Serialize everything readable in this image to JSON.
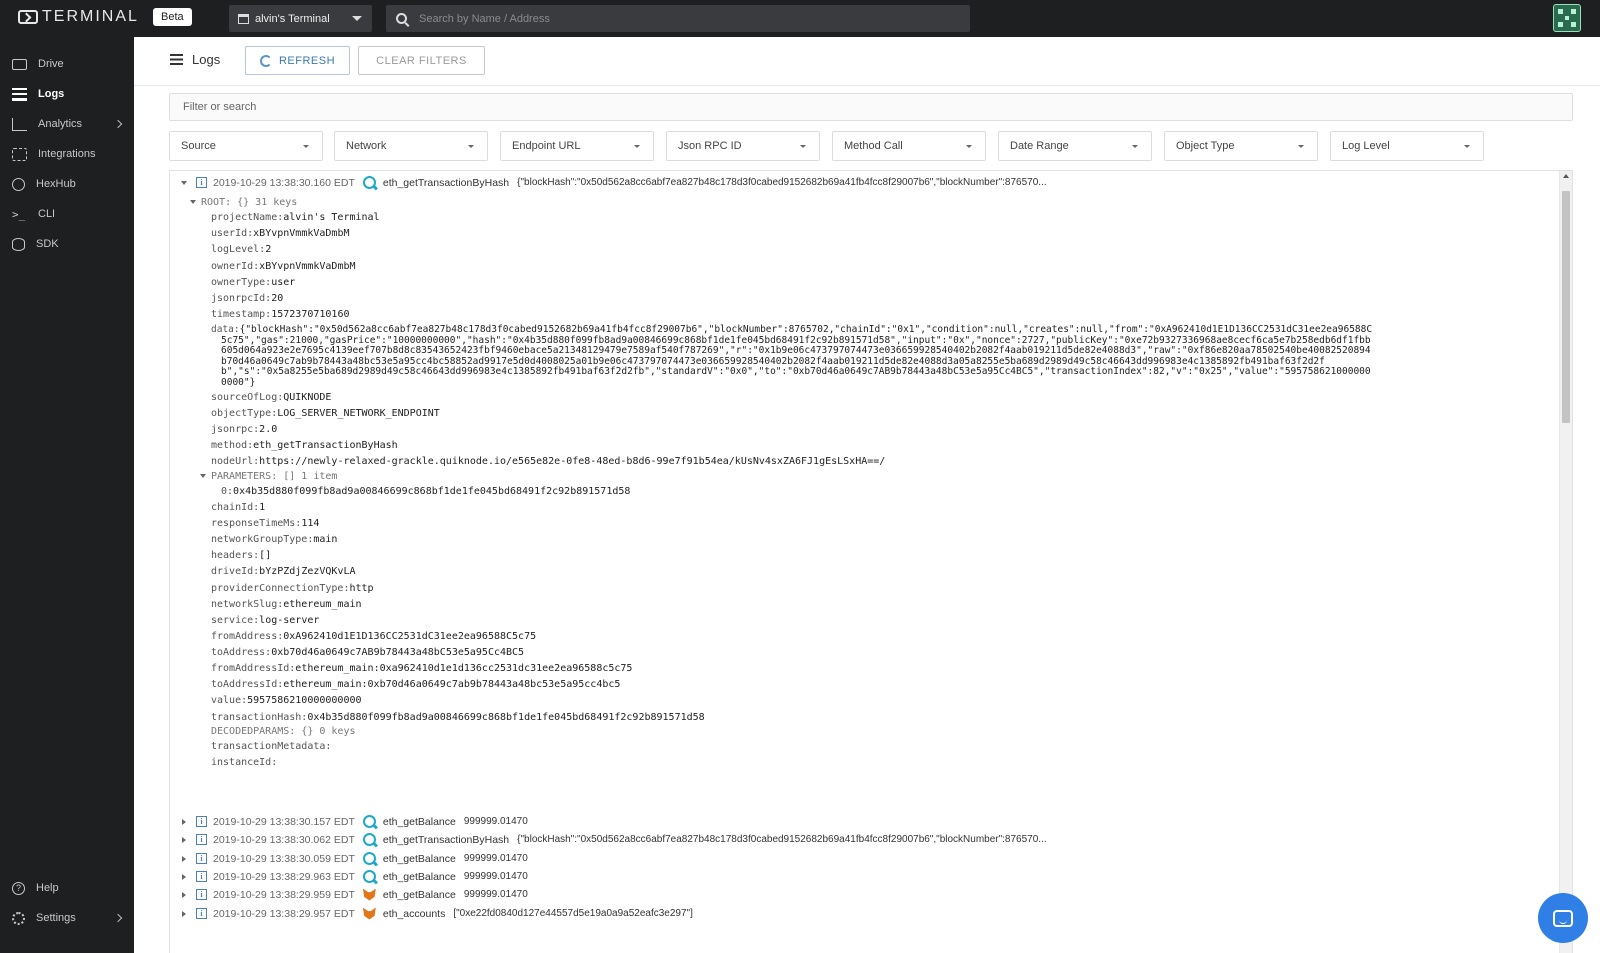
{
  "app": {
    "logo_text": "TERMINAL",
    "beta_label": "Beta",
    "project_name": "alvin's Terminal",
    "search_placeholder": "Search by Name / Address"
  },
  "sidebar": {
    "items": [
      {
        "label": "Drive",
        "icon": "folder-icon"
      },
      {
        "label": "Logs",
        "icon": "list-icon",
        "active": true
      },
      {
        "label": "Analytics",
        "icon": "chart-icon",
        "has_submenu": true
      },
      {
        "label": "Integrations",
        "icon": "plug-icon"
      },
      {
        "label": "HexHub",
        "icon": "globe-icon"
      },
      {
        "label": "CLI",
        "icon": "terminal-prompt-icon"
      },
      {
        "label": "SDK",
        "icon": "database-icon"
      }
    ],
    "bottom": [
      {
        "label": "Help",
        "icon": "help-icon"
      },
      {
        "label": "Settings",
        "icon": "gear-icon",
        "has_submenu": true
      }
    ]
  },
  "toolbar": {
    "title": "Logs",
    "refresh_label": "REFRESH",
    "clear_label": "CLEAR FILTERS",
    "filter_placeholder": "Filter or search"
  },
  "filters": [
    "Source",
    "Network",
    "Endpoint URL",
    "Json RPC ID",
    "Method Call",
    "Date Range",
    "Object Type",
    "Log Level"
  ],
  "expanded_log": {
    "timestamp": "2019-10-29  13:38:30.160  EDT",
    "method": "eth_getTransactionByHash",
    "payload": "{\"blockHash\":\"0x50d562a8cc6abf7ea827b48c178d3f0cabed9152682b69a41fb4fcc8f29007b6\",\"blockNumber\":876570...",
    "root_label": "ROOT:  {}  31 keys",
    "fields_a": [
      {
        "k": "projectName:",
        "v": "alvin's Terminal"
      },
      {
        "k": "userId:",
        "v": "xBYvpnVmmkVaDmbM"
      },
      {
        "k": "logLevel:",
        "v": "2"
      },
      {
        "k": "ownerId:",
        "v": "xBYvpnVmmkVaDmbM"
      },
      {
        "k": "ownerType:",
        "v": "user"
      },
      {
        "k": "jsonrpcId:",
        "v": "20"
      },
      {
        "k": "timestamp:",
        "v": "1572370710160"
      }
    ],
    "data_key": "data:",
    "data_lines": [
      "{\"blockHash\":\"0x50d562a8cc6abf7ea827b48c178d3f0cabed9152682b69a41fb4fcc8f29007b6\",\"blockNumber\":8765702,\"chainId\":\"0x1\",\"condition\":null,\"creates\":null,\"from\":\"0xA962410d1E1D136CC2531dC31ee2ea96588C",
      "5c75\",\"gas\":21000,\"gasPrice\":\"10000000000\",\"hash\":\"0x4b35d880f099fb8ad9a00846699c868bf1de1fe045bd68491f2c92b891571d58\",\"input\":\"0x\",\"nonce\":2727,\"publicKey\":\"0xe72b9327336968ae8cecf6ca5e7b258edb6df1fbb",
      "605d064a923e2e7695c4139eef707b8d8c83543652423fbf9460ebace5a21348129479e7589af540f787269\",\"r\":\"0x1b9e06c473797074473e036659928540402b2082f4aab019211d5de82e4088d3\",\"raw\":\"0xf86e820aa78502540be40082520894",
      "b70d46a0649c7ab9b78443a48bc53e5a95cc4bc58852ad9917e5d0d4008025a01b9e06c473797074473e036659928540402b2082f4aab019211d5de82e4088d3a05a8255e5ba689d2989d49c58c46643dd996983e4c1385892fb491baf63f2d2f",
      "b\",\"s\":\"0x5a8255e5ba689d2989d49c58c46643dd996983e4c1385892fb491baf63f2d2fb\",\"standardV\":\"0x0\",\"to\":\"0xb70d46a0649c7AB9b78443a48bC53e5a95Cc4BC5\",\"transactionIndex\":82,\"v\":\"0x25\",\"value\":\"595758621000000",
      "0000\"}"
    ],
    "fields_b": [
      {
        "k": "sourceOfLog:",
        "v": "QUIKNODE"
      },
      {
        "k": "objectType:",
        "v": "LOG_SERVER_NETWORK_ENDPOINT"
      },
      {
        "k": "jsonrpc:",
        "v": "2.0"
      },
      {
        "k": "method:",
        "v": "eth_getTransactionByHash"
      },
      {
        "k": "nodeUrl:",
        "v": "https://newly-relaxed-grackle.quiknode.io/e565e82e-0fe8-48ed-b8d6-99e7f91b54ea/kUsNv4sxZA6FJ1gEsLSxHA==/"
      }
    ],
    "params_label": "PARAMETERS:  []  1 item",
    "param0_key": "0:",
    "param0_value": "0x4b35d880f099fb8ad9a00846699c868bf1de1fe045bd68491f2c92b891571d58",
    "fields_c": [
      {
        "k": "chainId:",
        "v": "1"
      },
      {
        "k": "responseTimeMs:",
        "v": "114"
      },
      {
        "k": "networkGroupType:",
        "v": "main"
      },
      {
        "k": "headers:",
        "v": "[]"
      },
      {
        "k": "driveId:",
        "v": "bYzPZdjZezVQKvLA"
      },
      {
        "k": "providerConnectionType:",
        "v": "http"
      },
      {
        "k": "networkSlug:",
        "v": "ethereum_main"
      },
      {
        "k": "service:",
        "v": "log-server"
      },
      {
        "k": "fromAddress:",
        "v": "0xA962410d1E1D136CC2531dC31ee2ea96588C5c75"
      },
      {
        "k": "toAddress:",
        "v": "0xb70d46a0649c7AB9b78443a48bC53e5a95Cc4BC5"
      },
      {
        "k": "fromAddressId:",
        "v": "ethereum_main:0xa962410d1e1d136cc2531dc31ee2ea96588c5c75"
      },
      {
        "k": "toAddressId:",
        "v": "ethereum_main:0xb70d46a0649c7ab9b78443a48bc53e5a95cc4bc5"
      },
      {
        "k": "value:",
        "v": "5957586210000000000"
      },
      {
        "k": "transactionHash:",
        "v": "0x4b35d880f099fb8ad9a00846699c868bf1de1fe045bd68491f2c92b891571d58"
      }
    ],
    "decoded_label": "DECODEDPARAMS:  {}  0 keys",
    "tx_meta_key": "transactionMetadata:",
    "instance_key": "instanceId:"
  },
  "collapsed_logs": [
    {
      "timestamp": "2019-10-29  13:38:30.157  EDT",
      "source": "quiknode",
      "method": "eth_getBalance",
      "payload": "999999.01470"
    },
    {
      "timestamp": "2019-10-29  13:38:30.062  EDT",
      "source": "quiknode",
      "method": "eth_getTransactionByHash",
      "payload": "{\"blockHash\":\"0x50d562a8cc6abf7ea827b48c178d3f0cabed9152682b69a41fb4fcc8f29007b6\",\"blockNumber\":876570..."
    },
    {
      "timestamp": "2019-10-29  13:38:30.059  EDT",
      "source": "quiknode",
      "method": "eth_getBalance",
      "payload": "999999.01470"
    },
    {
      "timestamp": "2019-10-29  13:38:29.963  EDT",
      "source": "quiknode",
      "method": "eth_getBalance",
      "payload": "999999.01470"
    },
    {
      "timestamp": "2019-10-29  13:38:29.959  EDT",
      "source": "metamask",
      "method": "eth_getBalance",
      "payload": "999999.01470"
    },
    {
      "timestamp": "2019-10-29  13:38:29.957  EDT",
      "source": "metamask",
      "method": "eth_accounts",
      "payload": "[\"0xe22fd0840d127e44557d5e19a0a9a52eafc3e297\"]"
    }
  ],
  "colors": {
    "sidebar_bg": "#1e1f21",
    "accent": "#3c78b4",
    "quiknode": "#1fa9c8",
    "metamask": "#e2761b",
    "chat": "#2f7fe6"
  }
}
